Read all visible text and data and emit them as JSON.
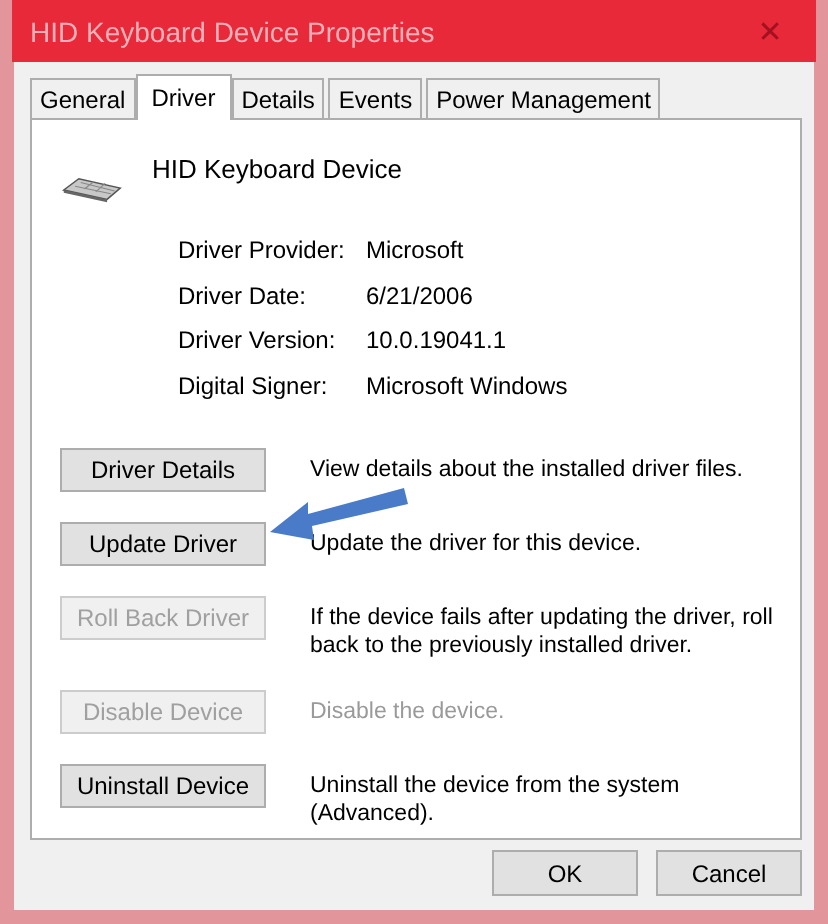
{
  "window": {
    "title": "HID Keyboard Device Properties",
    "close": "✕"
  },
  "tabs": [
    {
      "label": "General",
      "selected": false
    },
    {
      "label": "Driver",
      "selected": true
    },
    {
      "label": "Details",
      "selected": false
    },
    {
      "label": "Events",
      "selected": false
    },
    {
      "label": "Power Management",
      "selected": false
    }
  ],
  "device": {
    "name": "HID Keyboard Device"
  },
  "properties": [
    {
      "label": "Driver Provider:",
      "value": "Microsoft"
    },
    {
      "label": "Driver Date:",
      "value": "6/21/2006"
    },
    {
      "label": "Driver Version:",
      "value": "10.0.19041.1"
    },
    {
      "label": "Digital Signer:",
      "value": "Microsoft Windows"
    }
  ],
  "actions": [
    {
      "label": "Driver Details",
      "description": "View details about the installed driver files.",
      "disabled": false,
      "description_dimmed": false
    },
    {
      "label": "Update Driver",
      "description": "Update the driver for this device.",
      "disabled": false,
      "description_dimmed": false,
      "callout": true
    },
    {
      "label": "Roll Back Driver",
      "description": "If the device fails after updating the driver, roll back to the previously installed driver.",
      "disabled": true,
      "description_dimmed": false
    },
    {
      "label": "Disable Device",
      "description": "Disable the device.",
      "disabled": true,
      "description_dimmed": true
    },
    {
      "label": "Uninstall Device",
      "description": "Uninstall the device from the system (Advanced).",
      "disabled": false,
      "description_dimmed": false
    }
  ],
  "buttons": [
    "OK",
    "Cancel"
  ]
}
